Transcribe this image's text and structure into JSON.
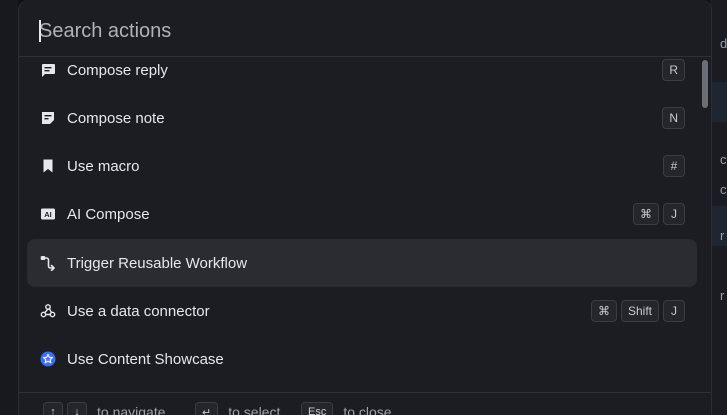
{
  "search": {
    "placeholder": "Search actions",
    "value": ""
  },
  "actions": [
    {
      "label": "Compose reply",
      "icon": "compose-reply-icon",
      "shortcut": [
        "R"
      ]
    },
    {
      "label": "Compose note",
      "icon": "note-icon",
      "shortcut": [
        "N"
      ]
    },
    {
      "label": "Use macro",
      "icon": "bookmark-icon",
      "shortcut": [
        "#"
      ]
    },
    {
      "label": "AI Compose",
      "icon": "ai-icon",
      "shortcut": [
        "⌘",
        "J"
      ]
    },
    {
      "label": "Trigger Reusable Workflow",
      "icon": "workflow-icon",
      "shortcut": [],
      "selected": true
    },
    {
      "label": "Use a data connector",
      "icon": "webhook-icon",
      "shortcut": [
        "⌘",
        "Shift",
        "J"
      ]
    },
    {
      "label": "Use Content Showcase",
      "icon": "star-badge-icon",
      "shortcut": []
    }
  ],
  "footer": {
    "navigate": {
      "keys": [
        "↑",
        "↓"
      ],
      "text": "to navigate"
    },
    "select": {
      "keys": [
        "↵"
      ],
      "text": "to select"
    },
    "close": {
      "keys": [
        "Esc"
      ],
      "text": "to close"
    }
  },
  "background_fragments": [
    "d",
    "c",
    "c",
    "r",
    "r"
  ],
  "colors": {
    "surface": "#1b1d22",
    "selected_row": "#2a2c32",
    "accent_blue": "#3b6ff5"
  }
}
